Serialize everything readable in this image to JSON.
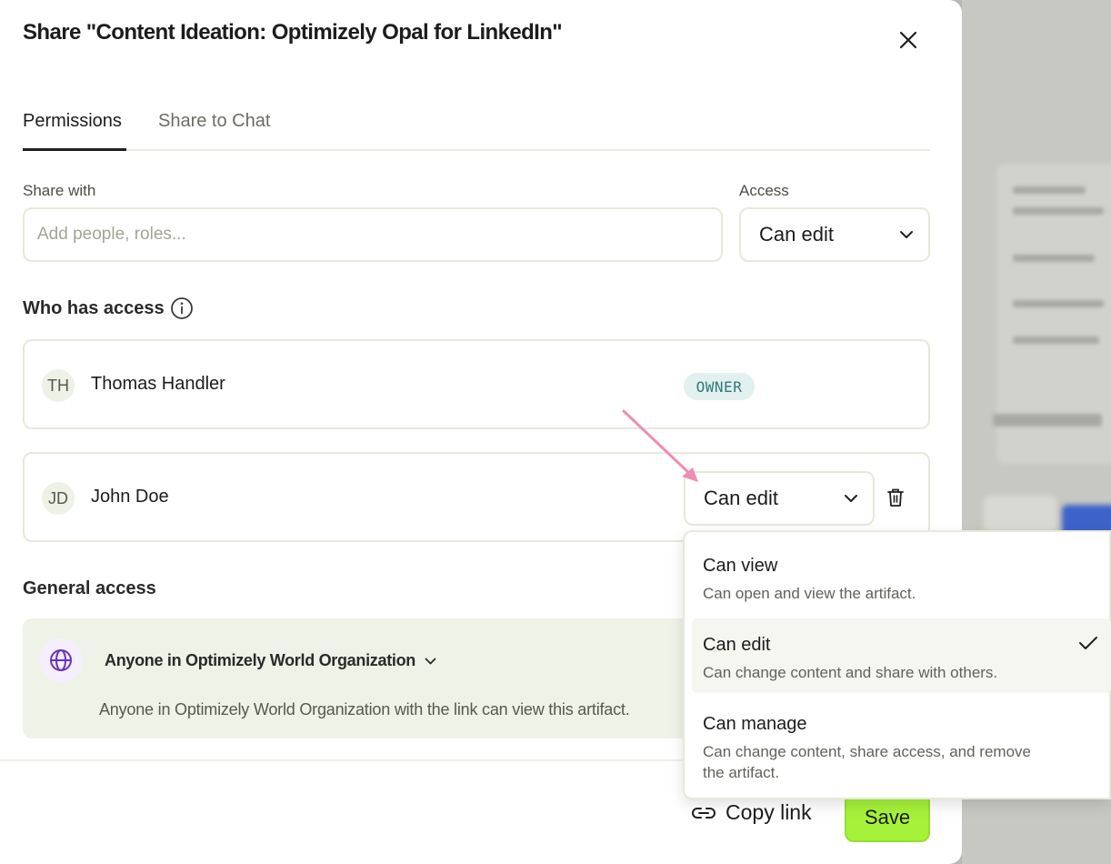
{
  "dialog": {
    "title": "Share \"Content Ideation: Optimizely Opal for LinkedIn\""
  },
  "tabs": [
    {
      "label": "Permissions",
      "active": true
    },
    {
      "label": "Share to Chat",
      "active": false
    }
  ],
  "share": {
    "label": "Share with",
    "placeholder": "Add people, roles...",
    "access_label": "Access",
    "access_value": "Can edit"
  },
  "who_has_access": {
    "title": "Who has access",
    "people": [
      {
        "initials": "TH",
        "name": "Thomas Handler",
        "badge": "OWNER"
      },
      {
        "initials": "JD",
        "name": "John Doe",
        "permission": "Can edit"
      }
    ]
  },
  "general_access": {
    "title": "General access",
    "scope": "Anyone in Optimizely World Organization",
    "description": "Anyone in Optimizely World Organization with the link can view this artifact."
  },
  "footer": {
    "copy_link": "Copy link",
    "save": "Save"
  },
  "permission_menu": {
    "items": [
      {
        "label": "Can view",
        "description": "Can open and view the artifact.",
        "selected": false
      },
      {
        "label": "Can edit",
        "description": "Can change content and share with others.",
        "selected": true
      },
      {
        "label": "Can manage",
        "description": "Can change content, share access, and remove the artifact.",
        "selected": false
      }
    ]
  },
  "colors": {
    "save_button": "#a6f23a",
    "owner_badge_bg": "#e2f0ef",
    "annotation_arrow": "#f08cb4",
    "globe_icon": "#6a2fc0"
  },
  "icons": [
    "close-icon",
    "info-icon",
    "chevron-down-icon",
    "trash-icon",
    "globe-icon",
    "link-icon",
    "check-icon"
  ]
}
